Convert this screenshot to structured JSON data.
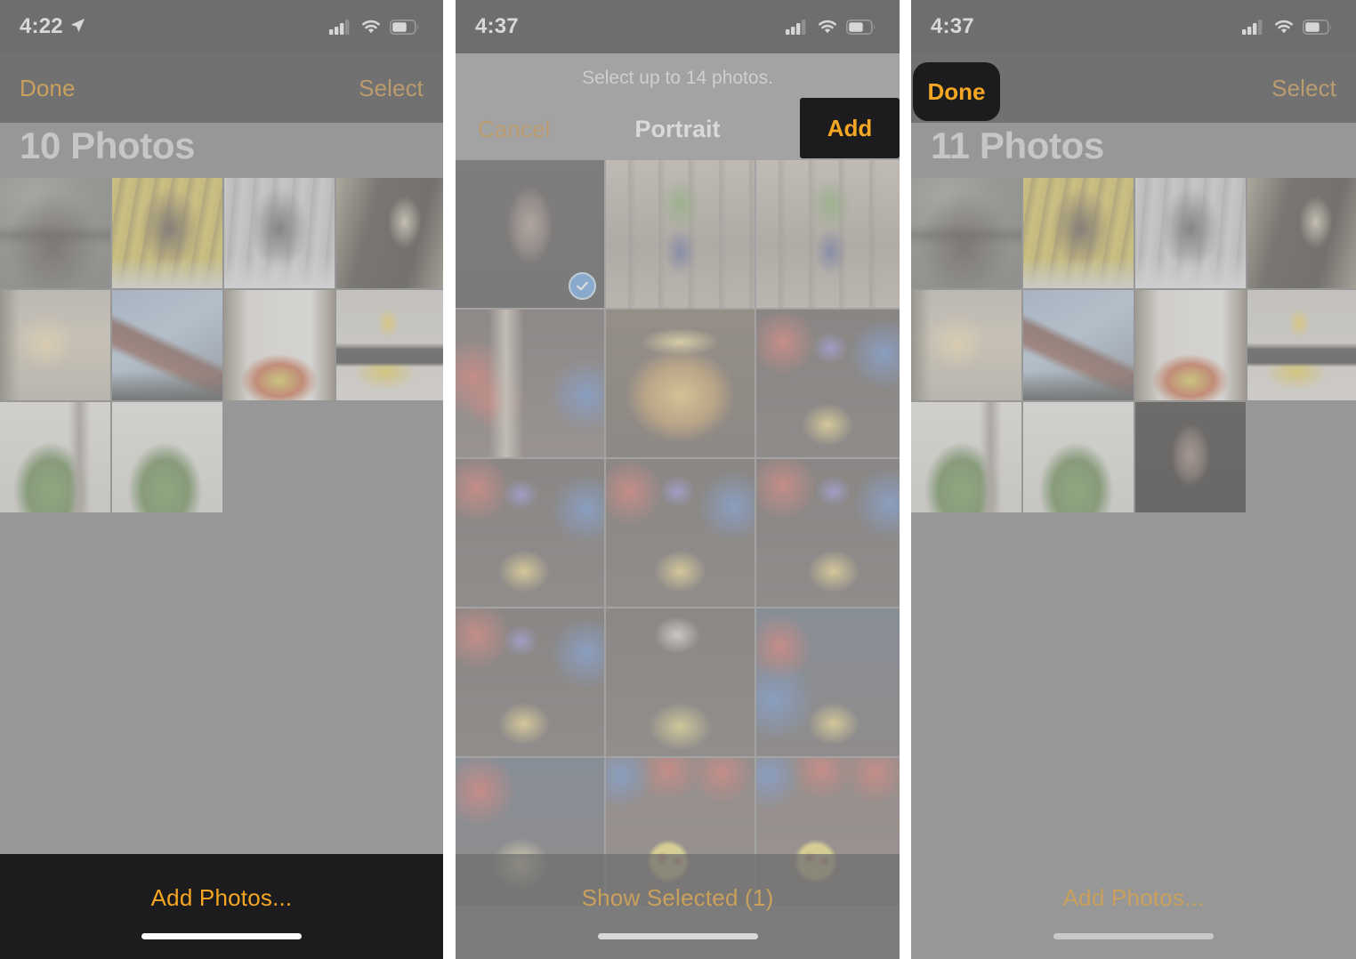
{
  "meta": {
    "accent_orange": "#f5a623",
    "accent_muted": "#c9a05c",
    "panel_bg": "#6e6e6e",
    "dark_bar": "#1c1c1e",
    "check_blue": "#2f7fd6"
  },
  "panel1": {
    "status": {
      "time": "4:22",
      "location_icon": "location-arrow-icon",
      "signal_icon": "cellular-signal-icon",
      "wifi_icon": "wifi-icon",
      "battery_icon": "battery-icon"
    },
    "nav": {
      "left_label": "Done",
      "right_label": "Select"
    },
    "title": "10 Photos",
    "bottom": {
      "action_label": "Add Photos...",
      "highlighted": true
    },
    "photos": [
      {
        "name": "man-with-sunglasses-portrait"
      },
      {
        "name": "man-yellow-wall-portrait"
      },
      {
        "name": "man-bw-portrait"
      },
      {
        "name": "hand-on-bamboo"
      },
      {
        "name": "foggy-sunrise-tree"
      },
      {
        "name": "rooftop-sky-palm"
      },
      {
        "name": "flower-bouquet-doorway"
      },
      {
        "name": "geeksmedia-number-one-cake"
      },
      {
        "name": "hulk-figure-closeup-a"
      },
      {
        "name": "hulk-figure-closeup-b"
      }
    ]
  },
  "panel2": {
    "status": {
      "time": "4:37",
      "signal_icon": "cellular-signal-icon",
      "wifi_icon": "wifi-icon",
      "battery_icon": "battery-icon"
    },
    "hint": "Select up to 14 photos.",
    "sheet": {
      "cancel_label": "Cancel",
      "title": "Portrait",
      "add_label": "Add",
      "add_highlighted": true
    },
    "bottom": {
      "action_label": "Show Selected (1)"
    },
    "photos": [
      {
        "name": "woman-dark-portrait",
        "selected": true
      },
      {
        "name": "hulk-standing-a"
      },
      {
        "name": "hulk-standing-b"
      },
      {
        "name": "birthday-couple-balloons"
      },
      {
        "name": "happy-birthday-cake-glow"
      },
      {
        "name": "boy-party-hat-cake-a"
      },
      {
        "name": "boy-party-hat-cake-b"
      },
      {
        "name": "boy-party-hat-cake-c"
      },
      {
        "name": "boy-party-hat-cake-d"
      },
      {
        "name": "boy-party-hat-cake-e"
      },
      {
        "name": "boy-party-hat-cake-f"
      },
      {
        "name": "boy-party-hat-cake-g"
      },
      {
        "name": "boy-candle-blowing"
      },
      {
        "name": "family-emoji-cake-a"
      },
      {
        "name": "family-emoji-cake-b"
      }
    ],
    "selected_count": 1
  },
  "panel3": {
    "status": {
      "time": "4:37",
      "signal_icon": "cellular-signal-icon",
      "wifi_icon": "wifi-icon",
      "battery_icon": "battery-icon"
    },
    "nav": {
      "left_label": "Done",
      "left_highlighted": true,
      "right_label": "Select"
    },
    "title": "11 Photos",
    "bottom": {
      "action_label": "Add Photos...",
      "highlighted": false
    },
    "photos": [
      {
        "name": "man-with-sunglasses-portrait"
      },
      {
        "name": "man-yellow-wall-portrait"
      },
      {
        "name": "man-bw-portrait"
      },
      {
        "name": "hand-on-bamboo"
      },
      {
        "name": "foggy-sunrise-tree"
      },
      {
        "name": "rooftop-sky-palm"
      },
      {
        "name": "flower-bouquet-doorway"
      },
      {
        "name": "geeksmedia-number-one-cake"
      },
      {
        "name": "hulk-figure-closeup-a"
      },
      {
        "name": "hulk-figure-closeup-b"
      },
      {
        "name": "woman-dark-portrait"
      }
    ]
  }
}
